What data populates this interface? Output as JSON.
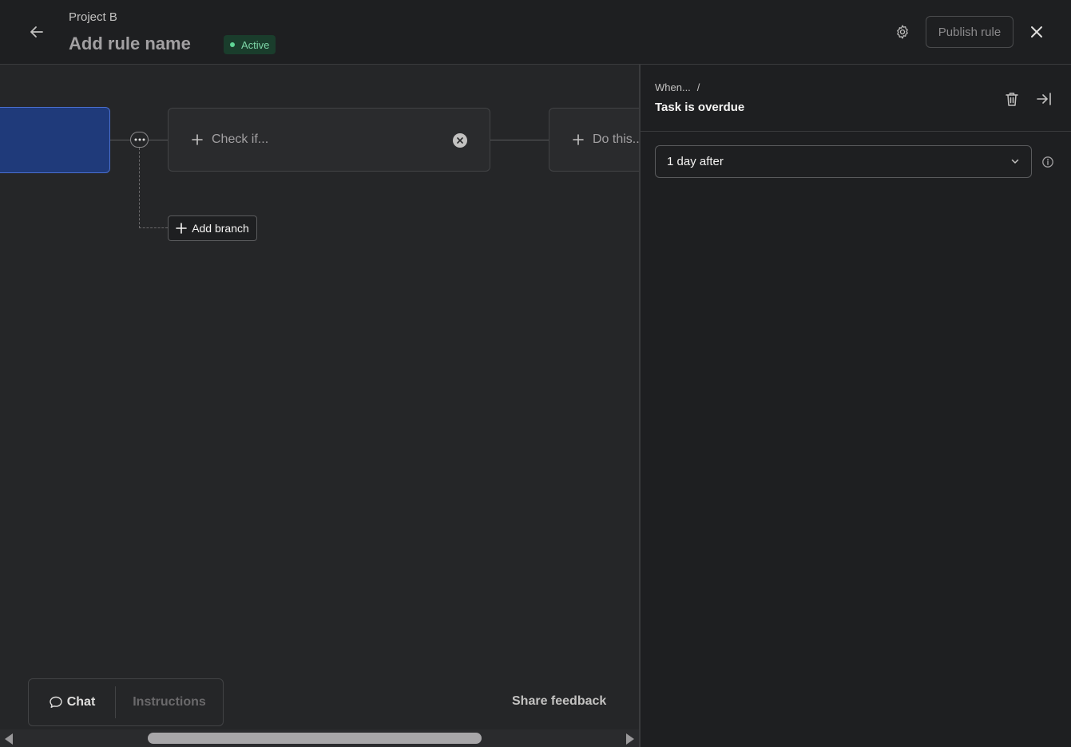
{
  "header": {
    "project": "Project B",
    "rule_name": "Add rule name",
    "status": "Active",
    "publish_label": "Publish rule",
    "icons": {
      "back": "arrow-left-icon",
      "settings": "gear-icon",
      "close": "close-icon"
    }
  },
  "canvas": {
    "check_label": "Check if...",
    "do_label": "Do this...",
    "add_branch_label": "Add branch"
  },
  "footer": {
    "chat_label": "Chat",
    "instructions_label": "Instructions",
    "share_feedback_label": "Share feedback"
  },
  "panel": {
    "breadcrumb": "When...",
    "breadcrumb_sep": "/",
    "title": "Task is overdue",
    "select_value": "1 day after"
  },
  "colors": {
    "background": "#252628",
    "header": "#1e1f21",
    "trigger_node": "#1f3a7a",
    "active_badge": "#1a3d2c"
  }
}
